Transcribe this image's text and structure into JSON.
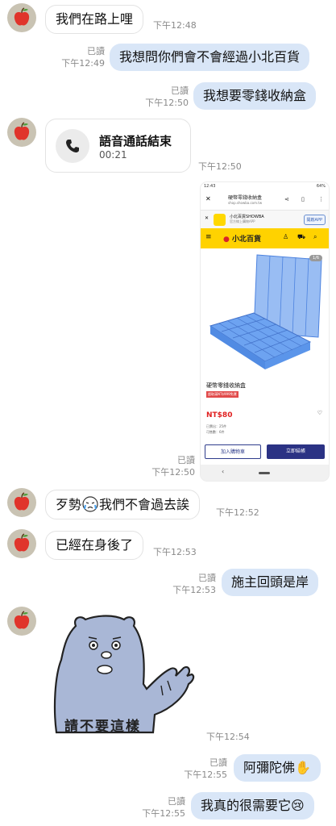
{
  "messages": {
    "m1": {
      "text": "我們在路上哩",
      "time": "下午12:48"
    },
    "m2": {
      "text": "我想問你們會不會經過小北百貨",
      "read": "已讀",
      "time": "下午12:49"
    },
    "m3": {
      "text": "我想要零錢收納盒",
      "read": "已讀",
      "time": "下午12:50"
    },
    "m4": {
      "title": "語音通話結束",
      "duration": "00:21",
      "time": "下午12:50"
    },
    "m5": {
      "read": "已讀",
      "time": "下午12:50"
    },
    "m6": {
      "text_before": "歹勢",
      "text_after": "我們不會過去誒",
      "time": "下午12:52"
    },
    "m7": {
      "text": "已經在身後了",
      "time": "下午12:53"
    },
    "m8": {
      "text": "施主回頭是岸",
      "read": "已讀",
      "time": "下午12:53"
    },
    "m9": {
      "sticker_text": "請不要這樣",
      "time": "下午12:54"
    },
    "m10": {
      "text": "阿彌陀佛",
      "emoji": "✋",
      "read": "已讀",
      "time": "下午12:55"
    },
    "m11": {
      "text": "我真的很需要它",
      "emoji": "😢",
      "read": "已讀",
      "time": "下午12:55"
    }
  },
  "screenshot": {
    "status_time": "12:43",
    "battery": "64%",
    "page_title": "硬幣零錢收納盒",
    "page_url": "shop.showba.com.tw",
    "app_name": "小北百貨SHOWBA",
    "app_desc": "官方線上購物APP",
    "open_app": "開啟APP",
    "brand": "小北百貨",
    "image_counter": "1/6",
    "product_name": "硬幣零錢收納盒",
    "promo_tag": "超取滿NT$999免運",
    "price": "NT$80",
    "sold": "已賣出：25件",
    "stock": "可售數：6件",
    "add_to_cart": "加入購物車",
    "buy_now": "立即結帳"
  },
  "colors": {
    "outgoing_bubble": "#d9e6f7",
    "incoming_bubble": "#ffffff",
    "brand_yellow": "#ffd200",
    "buy_button": "#2b3284"
  }
}
